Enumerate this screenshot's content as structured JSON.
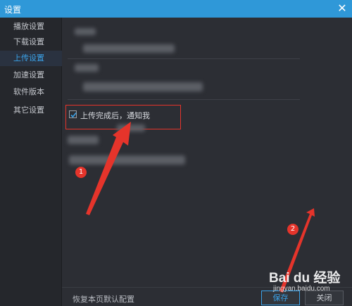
{
  "window": {
    "title": "设置",
    "close_icon": "close-icon"
  },
  "sidebar": {
    "items": [
      {
        "label": "播放设置",
        "active": false
      },
      {
        "label": "下载设置",
        "active": false
      },
      {
        "label": "上传设置",
        "active": true
      },
      {
        "label": "加速设置",
        "active": false
      },
      {
        "label": "软件版本",
        "active": false
      },
      {
        "label": "其它设置",
        "active": false
      }
    ]
  },
  "main": {
    "notify_checkbox": {
      "label": "上传完成后，通知我",
      "checked": true
    }
  },
  "footer": {
    "restore_label": "恢复本页默认配置",
    "save_label": "保存",
    "close_label": "关闭"
  },
  "annotations": {
    "badge_1": "1",
    "badge_2": "2",
    "color": "#e5342b"
  },
  "watermark": {
    "logo": "Bai du 经验",
    "url": "jingyan.baidu.com"
  },
  "colors": {
    "titlebar": "#2f98d8",
    "accent": "#3aa3ea",
    "background": "#2c2e34",
    "sidebar": "#25272c"
  }
}
